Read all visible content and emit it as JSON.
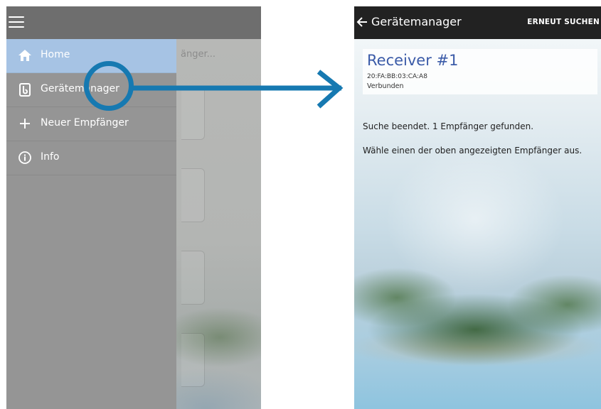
{
  "left": {
    "background_search_text": "änger...",
    "drawer_items": [
      {
        "label": "Home",
        "icon": "home-icon",
        "active": true
      },
      {
        "label": "Gerätemanager",
        "icon": "device-icon",
        "active": false
      },
      {
        "label": "Neuer Empfänger",
        "icon": "plus-icon",
        "active": false
      },
      {
        "label": "Info",
        "icon": "info-icon",
        "active": false
      }
    ]
  },
  "right": {
    "title": "Gerätemanager",
    "rescan_label": "ERNEUT SUCHEN",
    "receiver": {
      "name": "Receiver #1",
      "mac": "20:FA:BB:03:CA:A8",
      "status": "Verbunden"
    },
    "messages": [
      "Suche beendet. 1 Empfänger gefunden.",
      "Wähle einen der oben angezeigten Empfänger aus."
    ]
  },
  "colors": {
    "highlight": "#a6c3e4",
    "annotation": "#1679b1",
    "receiver_name": "#3b5ba8",
    "app_bar_dark": "#222222"
  }
}
